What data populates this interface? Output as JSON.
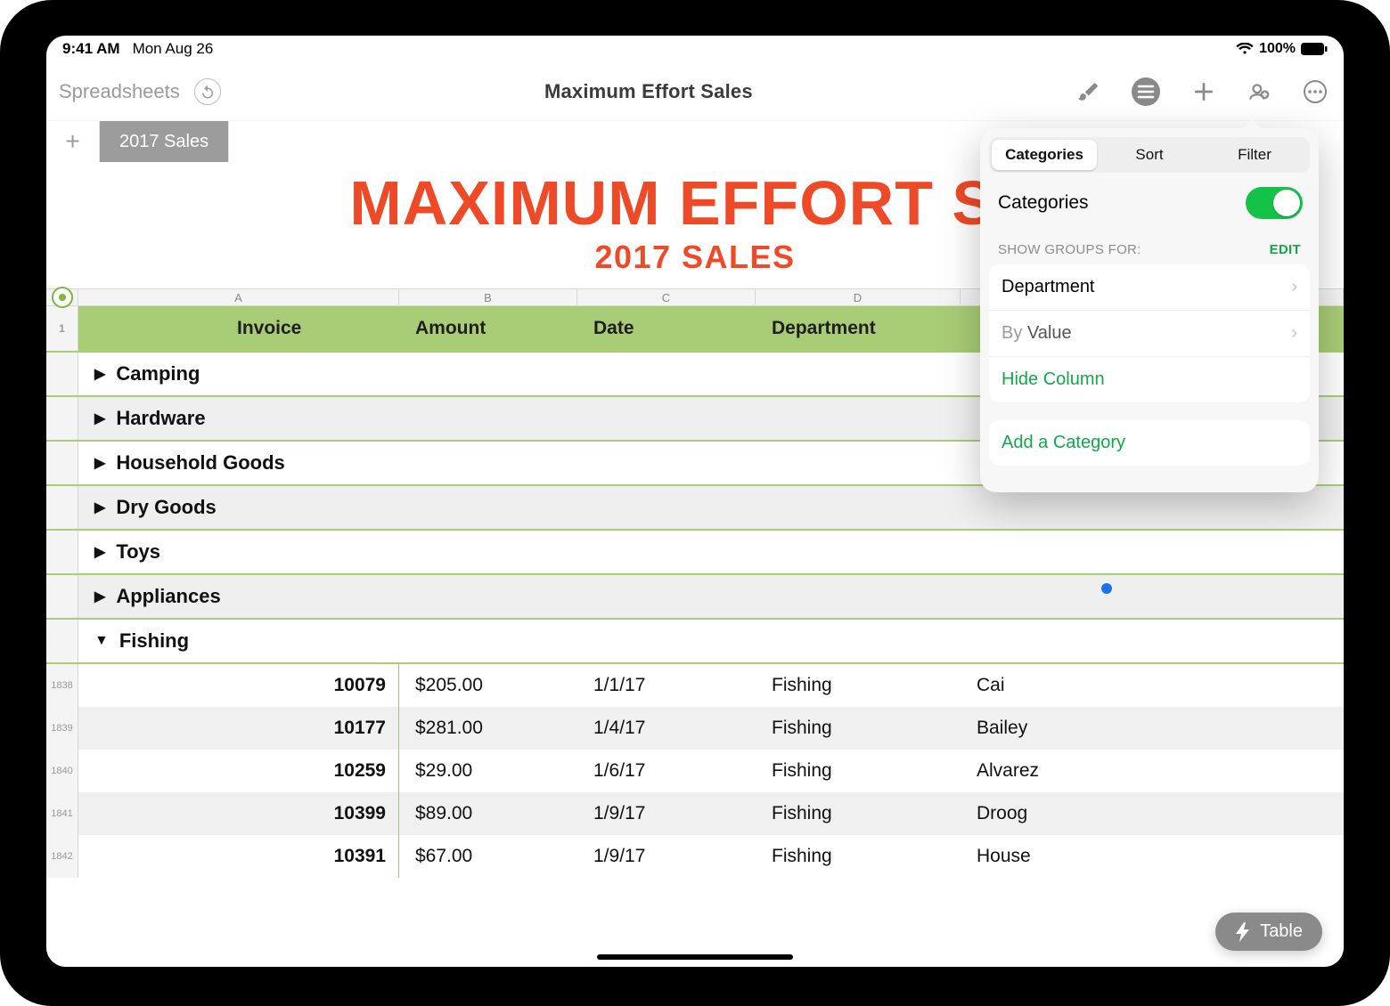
{
  "status": {
    "time": "9:41 AM",
    "date": "Mon Aug 26",
    "battery": "100%"
  },
  "toolbar": {
    "back": "Spreadsheets",
    "title": "Maximum Effort Sales"
  },
  "sheet_tab": "2017 Sales",
  "doc": {
    "title": "MAXIMUM EFFORT SU",
    "subtitle": "2017 SALES"
  },
  "columns": {
    "letters": [
      "A",
      "B",
      "C",
      "D"
    ],
    "headers": [
      "Invoice",
      "Amount",
      "Date",
      "Department"
    ]
  },
  "groups": [
    "Camping",
    "Hardware",
    "Household Goods",
    "Dry Goods",
    "Toys",
    "Appliances",
    "Fishing"
  ],
  "rows": [
    {
      "num": "1838",
      "invoice": "10079",
      "amount": "$205.00",
      "date": "1/1/17",
      "dept": "Fishing",
      "rep": "Cai"
    },
    {
      "num": "1839",
      "invoice": "10177",
      "amount": "$281.00",
      "date": "1/4/17",
      "dept": "Fishing",
      "rep": "Bailey"
    },
    {
      "num": "1840",
      "invoice": "10259",
      "amount": "$29.00",
      "date": "1/6/17",
      "dept": "Fishing",
      "rep": "Alvarez"
    },
    {
      "num": "1841",
      "invoice": "10399",
      "amount": "$89.00",
      "date": "1/9/17",
      "dept": "Fishing",
      "rep": "Droog"
    },
    {
      "num": "1842",
      "invoice": "10391",
      "amount": "$67.00",
      "date": "1/9/17",
      "dept": "Fishing",
      "rep": "House"
    }
  ],
  "popover": {
    "tabs": [
      "Categories",
      "Sort",
      "Filter"
    ],
    "toggle_label": "Categories",
    "section_head": "SHOW GROUPS FOR:",
    "edit": "EDIT",
    "group_by": "Department",
    "by_prefix": "By",
    "by_value": "Value",
    "hide": "Hide Column",
    "add": "Add a Category"
  },
  "float_button": "Table"
}
